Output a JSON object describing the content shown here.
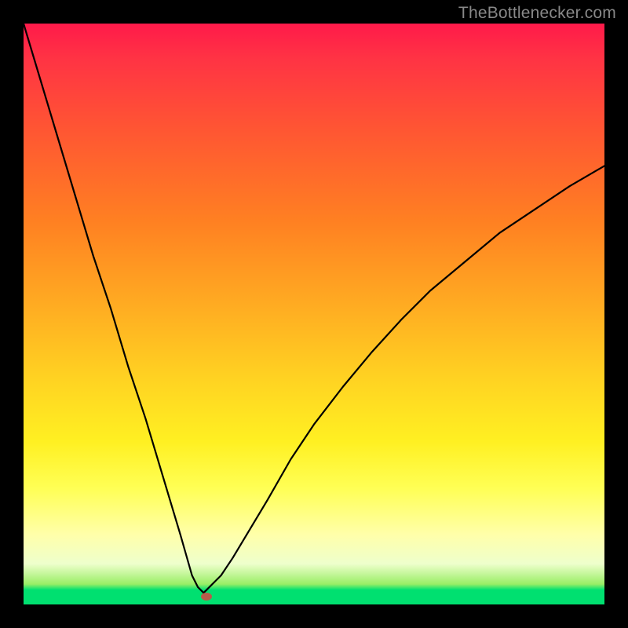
{
  "watermark": "TheBottlenecker.com",
  "chart_data": {
    "type": "line",
    "title": "",
    "xlabel": "",
    "ylabel": "",
    "xlim": [
      0,
      100
    ],
    "ylim": [
      0,
      100
    ],
    "x": [
      0,
      3,
      6,
      9,
      12,
      15,
      18,
      21,
      24,
      27,
      29,
      30,
      31,
      32,
      33,
      34,
      36,
      39,
      42,
      46,
      50,
      55,
      60,
      65,
      70,
      76,
      82,
      88,
      94,
      100
    ],
    "values": [
      100,
      90,
      80,
      70,
      60,
      51,
      41,
      32,
      22,
      12,
      5,
      3,
      2,
      3,
      4,
      5,
      8,
      13,
      18,
      25,
      31,
      37.5,
      43.5,
      49,
      54,
      59,
      64,
      68,
      72,
      75.5
    ],
    "marker": {
      "x": 31.5,
      "y": 1.4
    },
    "gradient_stops": [
      {
        "pos": 0.0,
        "color": "#ff1a4a"
      },
      {
        "pos": 0.34,
        "color": "#ff8022"
      },
      {
        "pos": 0.62,
        "color": "#ffd522"
      },
      {
        "pos": 0.88,
        "color": "#ffffaa"
      },
      {
        "pos": 0.975,
        "color": "#00e070"
      },
      {
        "pos": 1.0,
        "color": "#00e070"
      }
    ]
  }
}
